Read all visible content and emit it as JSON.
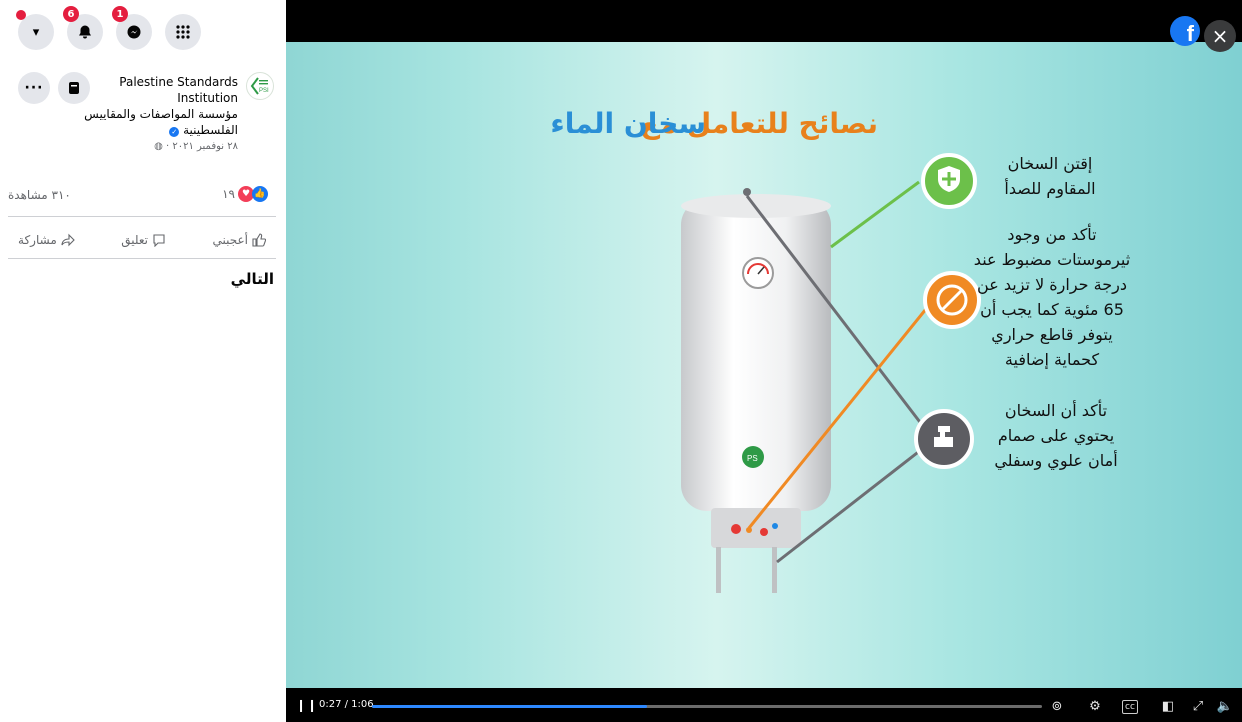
{
  "topbar": {
    "icons": [
      {
        "name": "account-menu-icon",
        "glyph": "▾",
        "badge": ""
      },
      {
        "name": "notifications-icon",
        "glyph": "🔔",
        "badge": "6"
      },
      {
        "name": "messenger-icon",
        "glyph": "◉",
        "badge": "1"
      },
      {
        "name": "apps-menu-icon",
        "glyph": "⠿",
        "badge": ""
      }
    ]
  },
  "post": {
    "page_name_en": "Palestine Standards Institution",
    "page_name_ar": "مؤسسة المواصفات والمقاييس الفلسطينية",
    "date": "٢٨ نوفمبر ٢٠٢١ ·",
    "logo_text": "PSI",
    "views": "٣١٠ مشاهدة",
    "reaction_count": "١٩",
    "actions": {
      "like": "أعجبني",
      "comment": "تعليق",
      "share": "مشاركة"
    },
    "next_label": "التالي"
  },
  "video": {
    "title_part1": "نصائح للتعامل مع",
    "title_part2": "سخان الماء",
    "tip1": "إقتن السخان المقاوم للصدأ",
    "tip2": "تأكد من وجود ثيرموستات مضبوط عند درجة حرارة لا تزيد عن 65 مئوية كما يجب أن يتوفر قاطع حراري كحماية إضافية",
    "tip3": "تأكد أن السخان يحتوي على صمام أمان علوي وسفلي",
    "heater_logo": "PS",
    "fb_glyph": "f",
    "close_glyph": "×",
    "time_display": "0:27 / 1:06",
    "progress": 0.41,
    "colors": {
      "title_orange": "#e8811c",
      "title_blue": "#2a8fd6",
      "green": "#6cc04a",
      "orange": "#f08a24",
      "gray": "#5d5d62",
      "progress": "#2d88ff"
    }
  }
}
